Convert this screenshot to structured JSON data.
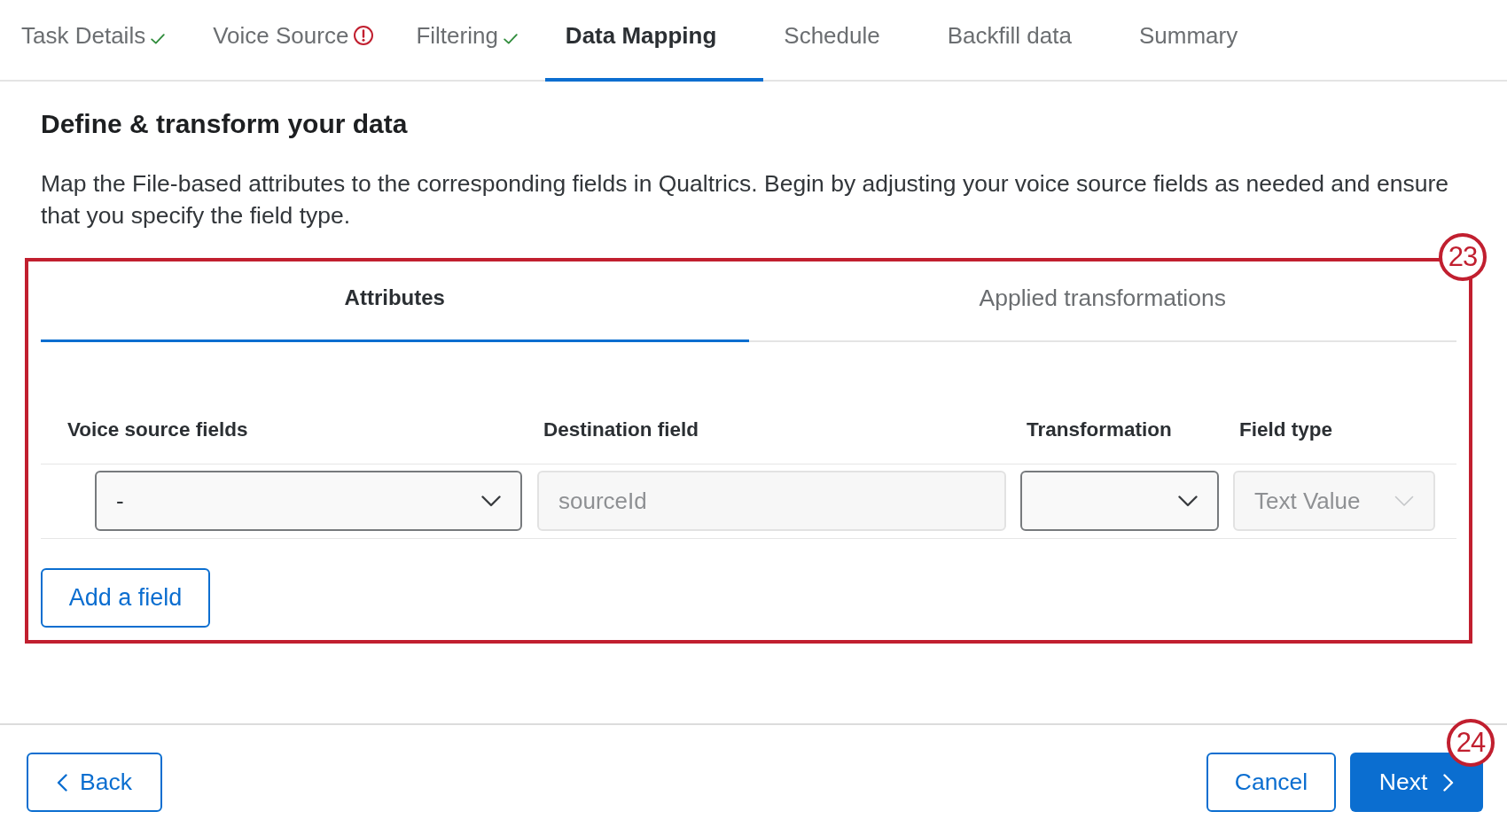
{
  "steps": [
    {
      "label": "Task Details",
      "complete": true,
      "error": false,
      "selected": false
    },
    {
      "label": "Voice Source",
      "complete": false,
      "error": true,
      "selected": false
    },
    {
      "label": "Filtering",
      "complete": true,
      "error": false,
      "selected": false
    },
    {
      "label": "Data Mapping",
      "complete": false,
      "error": false,
      "selected": true
    },
    {
      "label": "Schedule",
      "complete": false,
      "error": false,
      "selected": false
    },
    {
      "label": "Backfill data",
      "complete": false,
      "error": false,
      "selected": false
    },
    {
      "label": "Summary",
      "complete": false,
      "error": false,
      "selected": false
    }
  ],
  "heading": "Define & transform your data",
  "description": "Map the File-based attributes to the corresponding fields in Qualtrics. Begin by adjusting your voice source fields as needed and ensure that you specify the field type.",
  "mapping_panel": {
    "annotation": "23",
    "tabs": [
      {
        "label": "Attributes",
        "selected": true
      },
      {
        "label": "Applied transformations",
        "selected": false
      }
    ],
    "columns": [
      "Voice source fields",
      "Destination field",
      "Transformation",
      "Field type"
    ],
    "rows": [
      {
        "cells": [
          {
            "kind": "select",
            "value": "-",
            "disabled": false
          },
          {
            "kind": "input",
            "value": "sourceId",
            "disabled": true
          },
          {
            "kind": "select",
            "disabled": false
          },
          {
            "kind": "select",
            "value": "Text Value",
            "disabled": true
          }
        ]
      }
    ],
    "add_button": "Add a field"
  },
  "footer": {
    "back_button": "Back",
    "cancel_button": "Cancel",
    "next_button": {
      "label": "Next",
      "annotation": "24"
    }
  }
}
